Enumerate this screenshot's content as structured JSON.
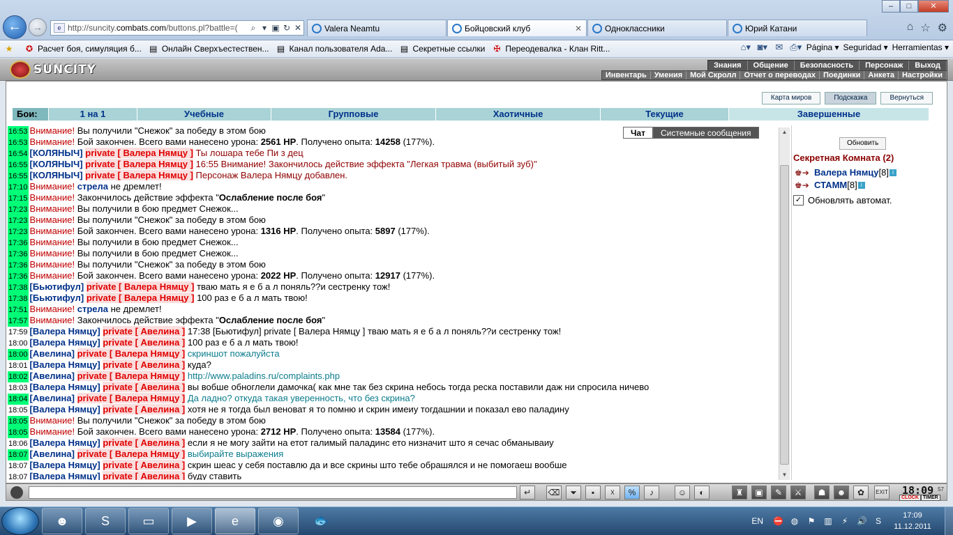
{
  "browser": {
    "url_prefix": "http://suncity.",
    "url_domain": "combats.com",
    "url_suffix": "/buttons.pl?battle=(",
    "tabs": [
      {
        "label": "Valera Neamtu"
      },
      {
        "label": "Бойцовский клуб"
      },
      {
        "label": "Одноклассники"
      },
      {
        "label": "Юрий Катани"
      }
    ],
    "favorites": [
      "Расчет боя, симуляция б...",
      "Онлайн Сверхъестествен...",
      "Канал пользователя Ada...",
      "Секретные ссылки",
      "Переодевалка - Клан Ritt..."
    ],
    "tools": {
      "page": "Página",
      "security": "Seguridad",
      "tools": "Herramientas"
    }
  },
  "game": {
    "logo": "SUNCITY",
    "menu_top": [
      "Знания",
      "Общение",
      "Безопасность",
      "Персонаж",
      "Выход"
    ],
    "menu_sub": [
      "Инвентарь",
      "Умения",
      "Мой Скролл",
      "Отчет о переводах",
      "Поединки",
      "Анкета",
      "Настройки"
    ],
    "top_buttons": {
      "worlds": "Карта миров",
      "hint": "Подсказка",
      "back": "Вернуться"
    },
    "fight_tabs": {
      "label": "Бои:",
      "items": [
        "1 на 1",
        "Учебные",
        "Групповые",
        "Хаотичные",
        "Текущие",
        "Завершенные"
      ]
    },
    "chat_tabs": {
      "chat": "Чат",
      "system": "Системные сообщения"
    },
    "right": {
      "refresh": "Обновить",
      "room": "Секретная Комната (2)",
      "users": [
        {
          "name": "Валера Нямцу",
          "level": "[8]"
        },
        {
          "name": "СТАММ",
          "level": "[8]"
        }
      ],
      "auto_refresh": "Обновлять автомат.",
      "info_icon_letter": "i"
    },
    "clock": {
      "time": "18:09",
      "sec": "57",
      "label_clock": "CLOCK",
      "label_timer": "TIMER"
    }
  },
  "chat": [
    {
      "t": "16:53",
      "g": true,
      "parts": [
        {
          "c": "warn",
          "x": "Внимание!"
        },
        {
          "x": " Вы получили \"Снежок\" за победу в этом бою"
        }
      ]
    },
    {
      "t": "16:53",
      "g": true,
      "parts": [
        {
          "c": "warn",
          "x": "Внимание!"
        },
        {
          "x": " Бой закончен. Всего вами нанесено урона: "
        },
        {
          "c": "bold",
          "x": "2561 HP"
        },
        {
          "x": ". Получено опыта: "
        },
        {
          "c": "bold",
          "x": "14258"
        },
        {
          "x": " (177%)."
        }
      ]
    },
    {
      "t": "16:54",
      "g": true,
      "parts": [
        {
          "c": "nick",
          "x": "[КОЛЯНЫЧ]"
        },
        {
          "x": " "
        },
        {
          "c": "pv",
          "x": "private [ Валера Нямцу ]"
        },
        {
          "c": "msg-red",
          "x": " Ты лошара тебе Пи з дец"
        }
      ]
    },
    {
      "t": "16:55",
      "g": true,
      "parts": [
        {
          "c": "nick",
          "x": "[КОЛЯНЫЧ]"
        },
        {
          "x": " "
        },
        {
          "c": "pv",
          "x": "private [ Валера Нямцу ]"
        },
        {
          "c": "msg-red",
          "x": " 16:55 Внимание! Закончилось действие эффекта \"Легкая травма (выбитый зуб)\""
        }
      ]
    },
    {
      "t": "16:55",
      "g": true,
      "parts": [
        {
          "c": "nick",
          "x": "[КОЛЯНЫЧ]"
        },
        {
          "x": " "
        },
        {
          "c": "pv",
          "x": "private [ Валера Нямцу ]"
        },
        {
          "c": "msg-red",
          "x": " Персонаж Валера Нямцу добавлен."
        }
      ]
    },
    {
      "t": "17:10",
      "g": true,
      "parts": [
        {
          "c": "warn",
          "x": "Внимание!"
        },
        {
          "x": " "
        },
        {
          "c": "nick",
          "x": "стрела"
        },
        {
          "x": " не дремлет!"
        }
      ]
    },
    {
      "t": "17:15",
      "g": true,
      "parts": [
        {
          "c": "warn",
          "x": "Внимание!"
        },
        {
          "x": " Закончилось действие эффекта \""
        },
        {
          "c": "bold",
          "x": "Ослабление после боя"
        },
        {
          "x": "\""
        }
      ]
    },
    {
      "t": "17:23",
      "g": true,
      "parts": [
        {
          "c": "warn",
          "x": "Внимание!"
        },
        {
          "x": " Вы получили в бою предмет Снежок..."
        }
      ]
    },
    {
      "t": "17:23",
      "g": true,
      "parts": [
        {
          "c": "warn",
          "x": "Внимание!"
        },
        {
          "x": " Вы получили \"Снежок\" за победу в этом бою"
        }
      ]
    },
    {
      "t": "17:23",
      "g": true,
      "parts": [
        {
          "c": "warn",
          "x": "Внимание!"
        },
        {
          "x": " Бой закончен. Всего вами нанесено урона: "
        },
        {
          "c": "bold",
          "x": "1316 HP"
        },
        {
          "x": ". Получено опыта: "
        },
        {
          "c": "bold",
          "x": "5897"
        },
        {
          "x": " (177%)."
        }
      ]
    },
    {
      "t": "17:36",
      "g": true,
      "parts": [
        {
          "c": "warn",
          "x": "Внимание!"
        },
        {
          "x": " Вы получили в бою предмет Снежок..."
        }
      ]
    },
    {
      "t": "17:36",
      "g": true,
      "parts": [
        {
          "c": "warn",
          "x": "Внимание!"
        },
        {
          "x": " Вы получили в бою предмет Снежок..."
        }
      ]
    },
    {
      "t": "17:36",
      "g": true,
      "parts": [
        {
          "c": "warn",
          "x": "Внимание!"
        },
        {
          "x": " Вы получили \"Снежок\" за победу в этом бою"
        }
      ]
    },
    {
      "t": "17:36",
      "g": true,
      "parts": [
        {
          "c": "warn",
          "x": "Внимание!"
        },
        {
          "x": " Бой закончен. Всего вами нанесено урона: "
        },
        {
          "c": "bold",
          "x": "2022 HP"
        },
        {
          "x": ". Получено опыта: "
        },
        {
          "c": "bold",
          "x": "12917"
        },
        {
          "x": " (177%)."
        }
      ]
    },
    {
      "t": "17:38",
      "g": true,
      "parts": [
        {
          "c": "nick",
          "x": "[Бьютифул]"
        },
        {
          "x": " "
        },
        {
          "c": "pv",
          "x": "private [ Валера Нямцу ]"
        },
        {
          "x": " тваю мать я е б а л поняль??и сестренку тож!"
        }
      ]
    },
    {
      "t": "17:38",
      "g": true,
      "parts": [
        {
          "c": "nick",
          "x": "[Бьютифул]"
        },
        {
          "x": " "
        },
        {
          "c": "pv",
          "x": "private [ Валера Нямцу ]"
        },
        {
          "x": " 100 раз е б а л мать твою!"
        }
      ]
    },
    {
      "t": "17:51",
      "g": true,
      "parts": [
        {
          "c": "warn",
          "x": "Внимание!"
        },
        {
          "x": " "
        },
        {
          "c": "nick",
          "x": "стрела"
        },
        {
          "x": " не дремлет!"
        }
      ]
    },
    {
      "t": "17:57",
      "g": true,
      "parts": [
        {
          "c": "warn",
          "x": "Внимание!"
        },
        {
          "x": " Закончилось действие эффекта \""
        },
        {
          "c": "bold",
          "x": "Ослабление после боя"
        },
        {
          "x": "\""
        }
      ]
    },
    {
      "t": "17:59",
      "g": false,
      "parts": [
        {
          "c": "nick",
          "x": "[Валера Нямцу]"
        },
        {
          "x": " "
        },
        {
          "c": "pv",
          "x": "private [ Авелина ]"
        },
        {
          "x": " 17:38 [Бьютифул] private [ Валера Нямцу ] тваю мать я е б а л поняль??и сестренку тож!"
        }
      ]
    },
    {
      "t": "18:00",
      "g": false,
      "parts": [
        {
          "c": "nick",
          "x": "[Валера Нямцу]"
        },
        {
          "x": " "
        },
        {
          "c": "pv",
          "x": "private [ Авелина ]"
        },
        {
          "x": " 100 раз е б а л мать твою!"
        }
      ]
    },
    {
      "t": "18:00",
      "g": true,
      "parts": [
        {
          "c": "nick",
          "x": "[Авелина]"
        },
        {
          "x": " "
        },
        {
          "c": "pv",
          "x": "private [ Валера Нямцу ]"
        },
        {
          "c": "msg-teal",
          "x": " скриншот пожалуйста"
        }
      ]
    },
    {
      "t": "18:01",
      "g": false,
      "parts": [
        {
          "c": "nick",
          "x": "[Валера Нямцу]"
        },
        {
          "x": " "
        },
        {
          "c": "pv",
          "x": "private [ Авелина ]"
        },
        {
          "x": " куда?"
        }
      ]
    },
    {
      "t": "18:02",
      "g": true,
      "parts": [
        {
          "c": "nick",
          "x": "[Авелина]"
        },
        {
          "x": " "
        },
        {
          "c": "pv",
          "x": "private [ Валера Нямцу ]"
        },
        {
          "c": "msg-teal",
          "x": " http://www.paladins.ru/complaints.php"
        }
      ]
    },
    {
      "t": "18:03",
      "g": false,
      "parts": [
        {
          "c": "nick",
          "x": "[Валера Нямцу]"
        },
        {
          "x": " "
        },
        {
          "c": "pv",
          "x": "private [ Авелина ]"
        },
        {
          "x": " вы вобше обноглели дамочка( как мне так без скрина небось тогда реска поставили даж ни спросила ничево"
        }
      ]
    },
    {
      "t": "18:04",
      "g": true,
      "parts": [
        {
          "c": "nick",
          "x": "[Авелина]"
        },
        {
          "x": " "
        },
        {
          "c": "pv",
          "x": "private [ Валера Нямцу ]"
        },
        {
          "c": "msg-teal",
          "x": " Да ладно? откуда такая уверенность, что без скрина?"
        }
      ]
    },
    {
      "t": "18:05",
      "g": false,
      "parts": [
        {
          "c": "nick",
          "x": "[Валера Нямцу]"
        },
        {
          "x": " "
        },
        {
          "c": "pv",
          "x": "private [ Авелина ]"
        },
        {
          "x": " хотя не я тогда был веноват я то помню и скрин имеиу тогдашнии и показал ево паладину"
        }
      ]
    },
    {
      "t": "18:05",
      "g": true,
      "parts": [
        {
          "c": "warn",
          "x": "Внимание!"
        },
        {
          "x": " Вы получили \"Снежок\" за победу в этом бою"
        }
      ]
    },
    {
      "t": "18:05",
      "g": true,
      "parts": [
        {
          "c": "warn",
          "x": "Внимание!"
        },
        {
          "x": " Бой закончен. Всего вами нанесено урона: "
        },
        {
          "c": "bold",
          "x": "2712 HP"
        },
        {
          "x": ". Получено опыта: "
        },
        {
          "c": "bold",
          "x": "13584"
        },
        {
          "x": " (177%)."
        }
      ]
    },
    {
      "t": "18:06",
      "g": false,
      "parts": [
        {
          "c": "nick",
          "x": "[Валера Нямцу]"
        },
        {
          "x": " "
        },
        {
          "c": "pv",
          "x": "private [ Авелина ]"
        },
        {
          "x": " если я не могу зайти на етот галимый паладинс ето низначит што я сечас обманываиу"
        }
      ]
    },
    {
      "t": "18:07",
      "g": true,
      "parts": [
        {
          "c": "nick",
          "x": "[Авелина]"
        },
        {
          "x": " "
        },
        {
          "c": "pv",
          "x": "private [ Валера Нямцу ]"
        },
        {
          "c": "msg-teal",
          "x": " выбирайте выражения"
        }
      ]
    },
    {
      "t": "18:07",
      "g": false,
      "parts": [
        {
          "c": "nick",
          "x": "[Валера Нямцу]"
        },
        {
          "x": " "
        },
        {
          "c": "pv",
          "x": "private [ Авелина ]"
        },
        {
          "x": " скрин шеас у себя поставлю да и все скрины што тебе обрашялся и не помогаеш вообше"
        }
      ]
    },
    {
      "t": "18:07",
      "g": false,
      "parts": [
        {
          "c": "nick",
          "x": "[Валера Нямцу]"
        },
        {
          "x": " "
        },
        {
          "c": "pv",
          "x": "private [ Авелина ]"
        },
        {
          "x": " буду ставить"
        }
      ]
    }
  ],
  "taskbar": {
    "lang": "EN",
    "time": "17:09",
    "date": "11.12.2011"
  }
}
